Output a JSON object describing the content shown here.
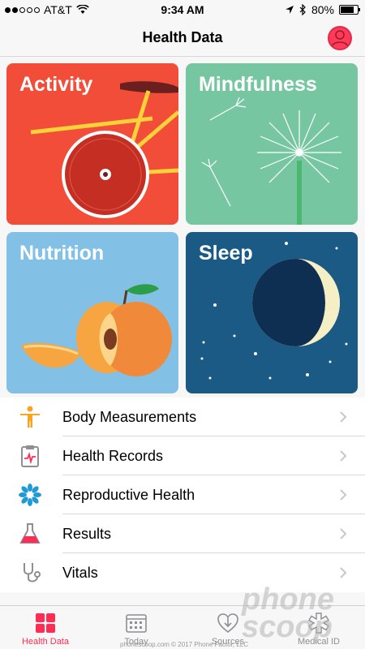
{
  "status_bar": {
    "carrier": "AT&T",
    "time": "9:34 AM",
    "battery": "80%",
    "battery_level": 0.8
  },
  "nav": {
    "title": "Health Data"
  },
  "tiles": [
    {
      "label": "Activity",
      "color": "#f24d38"
    },
    {
      "label": "Mindfulness",
      "color": "#76c7a1"
    },
    {
      "label": "Nutrition",
      "color": "#82c1e5"
    },
    {
      "label": "Sleep",
      "color": "#1a5a84"
    }
  ],
  "list": [
    {
      "label": "Body Measurements",
      "icon": "body-figure-icon"
    },
    {
      "label": "Health Records",
      "icon": "clipboard-icon"
    },
    {
      "label": "Reproductive Health",
      "icon": "flower-icon"
    },
    {
      "label": "Results",
      "icon": "flask-icon"
    },
    {
      "label": "Vitals",
      "icon": "stethoscope-icon"
    }
  ],
  "tabs": [
    {
      "label": "Health Data",
      "icon": "grid-icon",
      "active": true
    },
    {
      "label": "Today",
      "icon": "calendar-icon",
      "active": false
    },
    {
      "label": "Sources",
      "icon": "download-heart-icon",
      "active": false
    },
    {
      "label": "Medical ID",
      "icon": "asterisk-icon",
      "active": false
    }
  ],
  "watermark": {
    "line1": "phone",
    "line2": "scoop",
    "site": "phonescoop.com",
    "copyright": "© 2017 Phone Factor, LLC"
  },
  "accent_color": "#ff2d55"
}
